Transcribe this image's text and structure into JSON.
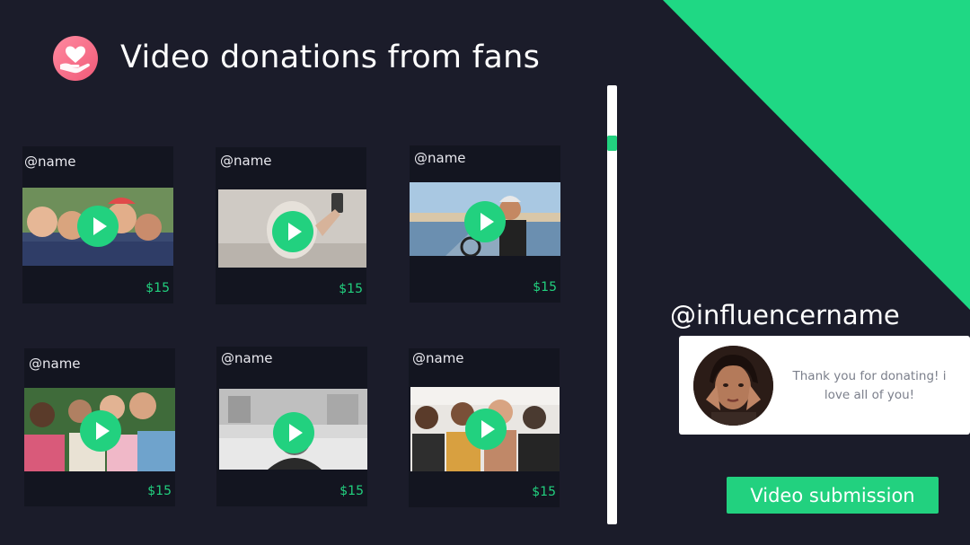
{
  "header": {
    "title": "Video donations from fans",
    "logo_icon": "heart-in-hand-icon"
  },
  "videos": [
    {
      "username": "@name",
      "price": "$15"
    },
    {
      "username": "@name",
      "price": "$15"
    },
    {
      "username": "@name",
      "price": "$15"
    },
    {
      "username": "@name",
      "price": "$15"
    },
    {
      "username": "@name",
      "price": "$15"
    },
    {
      "username": "@name",
      "price": "$15"
    }
  ],
  "influencer": {
    "handle": "@influencername",
    "message": "Thank you for donating! i love all of you!"
  },
  "actions": {
    "submit_label": "Video submission"
  },
  "colors": {
    "background": "#1b1c2a",
    "card": "#131520",
    "accent": "#22d17f",
    "logo": "#f05a78"
  }
}
